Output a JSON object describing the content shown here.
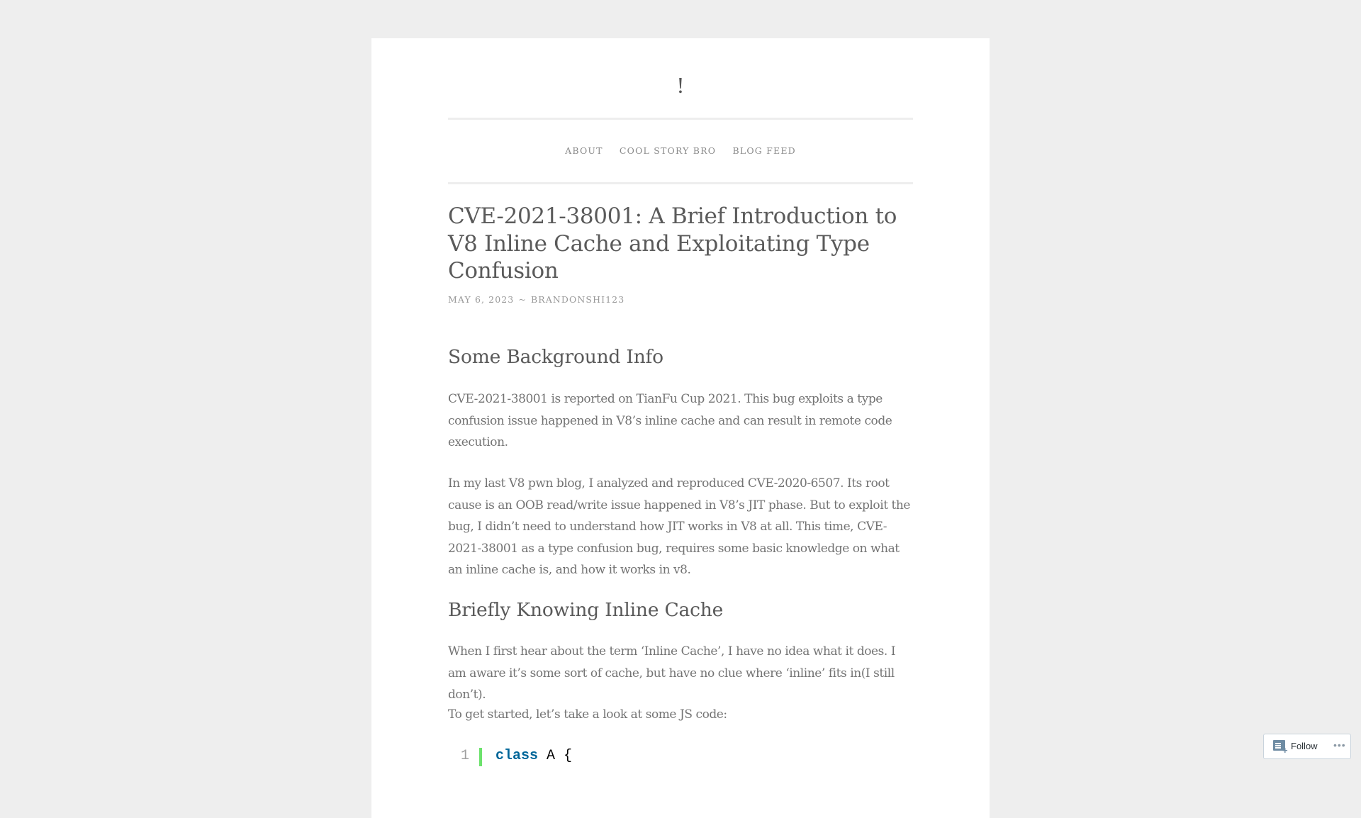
{
  "site": {
    "title": "!",
    "nav": [
      {
        "label": "About"
      },
      {
        "label": "Cool Story Bro"
      },
      {
        "label": "Blog Feed"
      }
    ]
  },
  "post": {
    "title": "CVE-2021-38001: A Brief Introduction to V8 Inline Cache and Exploitating Type Confusion",
    "date": "May 6, 2023",
    "separator": "~",
    "author": "brandonshi123",
    "sections": [
      {
        "heading": "Some Background Info",
        "paragraphs": [
          "CVE-2021-38001 is reported on TianFu Cup 2021. This bug exploits a type confusion issue happened in V8’s inline cache and can result in remote code execution.",
          "In my last V8 pwn blog, I analyzed and reproduced CVE-2020-6507. Its root cause is an OOB read/write issue happened in V8’s JIT phase. But to exploit the bug, I didn’t need to understand how JIT works in V8 at all. This time, CVE-2021-38001 as a type confusion bug, requires some basic knowledge on what an inline cache is, and how it works in v8."
        ]
      },
      {
        "heading": "Briefly Knowing Inline Cache",
        "paragraphs": [
          "When I first hear about the term ‘Inline Cache’, I have no idea what it does. I am aware it’s some sort of cache, but have no clue where ‘inline’ fits in(I still don’t).",
          "To get started, let’s take a look at some JS code:"
        ]
      }
    ],
    "code": {
      "lines": [
        {
          "number": "1",
          "keyword": "class",
          "rest": " A {"
        }
      ]
    }
  },
  "follow_widget": {
    "label": "Follow",
    "more": "•••"
  }
}
